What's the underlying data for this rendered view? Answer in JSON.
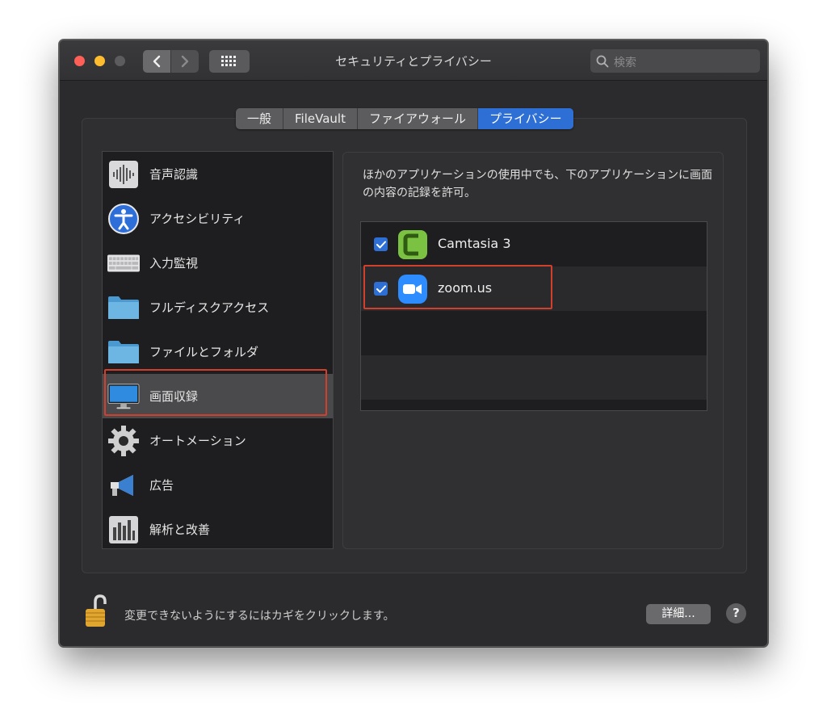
{
  "window": {
    "title": "セキュリティとプライバシー",
    "search_placeholder": "検索"
  },
  "tabs": [
    {
      "label": "一般",
      "active": false
    },
    {
      "label": "FileVault",
      "active": false
    },
    {
      "label": "ファイアウォール",
      "active": false
    },
    {
      "label": "プライバシー",
      "active": true
    }
  ],
  "sidebar": {
    "items": [
      {
        "label": "音声認識",
        "icon": "waveform-icon"
      },
      {
        "label": "アクセシビリティ",
        "icon": "accessibility-icon"
      },
      {
        "label": "入力監視",
        "icon": "keyboard-icon"
      },
      {
        "label": "フルディスクアクセス",
        "icon": "folder-icon"
      },
      {
        "label": "ファイルとフォルダ",
        "icon": "folder-icon"
      },
      {
        "label": "画面収録",
        "icon": "monitor-icon",
        "selected": true
      },
      {
        "label": "オートメーション",
        "icon": "gear-icon"
      },
      {
        "label": "広告",
        "icon": "megaphone-icon"
      },
      {
        "label": "解析と改善",
        "icon": "bar-chart-icon"
      }
    ]
  },
  "main": {
    "description": "ほかのアプリケーションの使用中でも、下のアプリケーションに画面の内容の記録を許可。",
    "apps": [
      {
        "name": "Camtasia 3",
        "checked": true,
        "icon": "camtasia-icon"
      },
      {
        "name": "zoom.us",
        "checked": true,
        "icon": "zoom-icon"
      }
    ]
  },
  "footer": {
    "lock_text": "変更できないようにするにはカギをクリックします。",
    "details_label": "詳細...",
    "help_label": "?"
  },
  "colors": {
    "accent": "#2e6fd6",
    "highlight": "#d0402c",
    "window_bg": "#2b2b2d"
  }
}
